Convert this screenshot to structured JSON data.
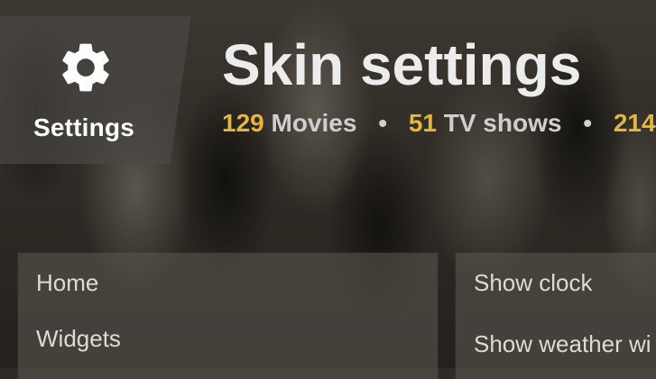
{
  "header": {
    "section_label": "Settings",
    "section_icon": "gear-icon",
    "title": "Skin settings",
    "stats": [
      {
        "count": "129",
        "label": "Movies"
      },
      {
        "count": "51",
        "label": "TV shows"
      },
      {
        "count": "214",
        "label": ""
      }
    ],
    "separator": "•"
  },
  "left_menu": {
    "items": [
      {
        "label": "Home"
      },
      {
        "label": "Widgets"
      }
    ]
  },
  "right_menu": {
    "items": [
      {
        "label": "Show clock"
      },
      {
        "label": "Show weather wi"
      }
    ]
  },
  "colors": {
    "accent_number": "#e8b53b",
    "title_text": "#ececec",
    "muted_text": "#cfcfcf"
  }
}
